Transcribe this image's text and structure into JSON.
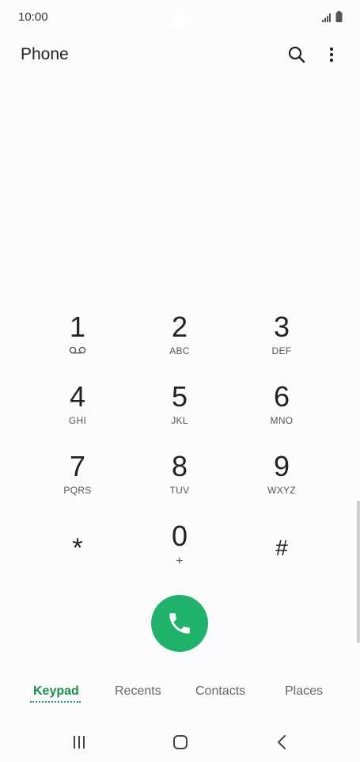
{
  "status": {
    "time": "10:00"
  },
  "header": {
    "title": "Phone",
    "search_icon": "search-icon",
    "more_icon": "more-vert-icon"
  },
  "keypad": [
    {
      "digit": "1",
      "sub": "",
      "icon": "voicemail-icon"
    },
    {
      "digit": "2",
      "sub": "ABC"
    },
    {
      "digit": "3",
      "sub": "DEF"
    },
    {
      "digit": "4",
      "sub": "GHI"
    },
    {
      "digit": "5",
      "sub": "JKL"
    },
    {
      "digit": "6",
      "sub": "MNO"
    },
    {
      "digit": "7",
      "sub": "PQRS"
    },
    {
      "digit": "8",
      "sub": "TUV"
    },
    {
      "digit": "9",
      "sub": "WXYZ"
    },
    {
      "digit": "*",
      "sub": ""
    },
    {
      "digit": "0",
      "sub": "+"
    },
    {
      "digit": "#",
      "sub": ""
    }
  ],
  "call_button": {
    "icon": "phone-icon",
    "color": "#1fb26a"
  },
  "tabs": [
    {
      "label": "Keypad",
      "active": true
    },
    {
      "label": "Recents"
    },
    {
      "label": "Contacts"
    },
    {
      "label": "Places"
    }
  ],
  "colors": {
    "accent": "#15914f",
    "call": "#1fb26a"
  }
}
